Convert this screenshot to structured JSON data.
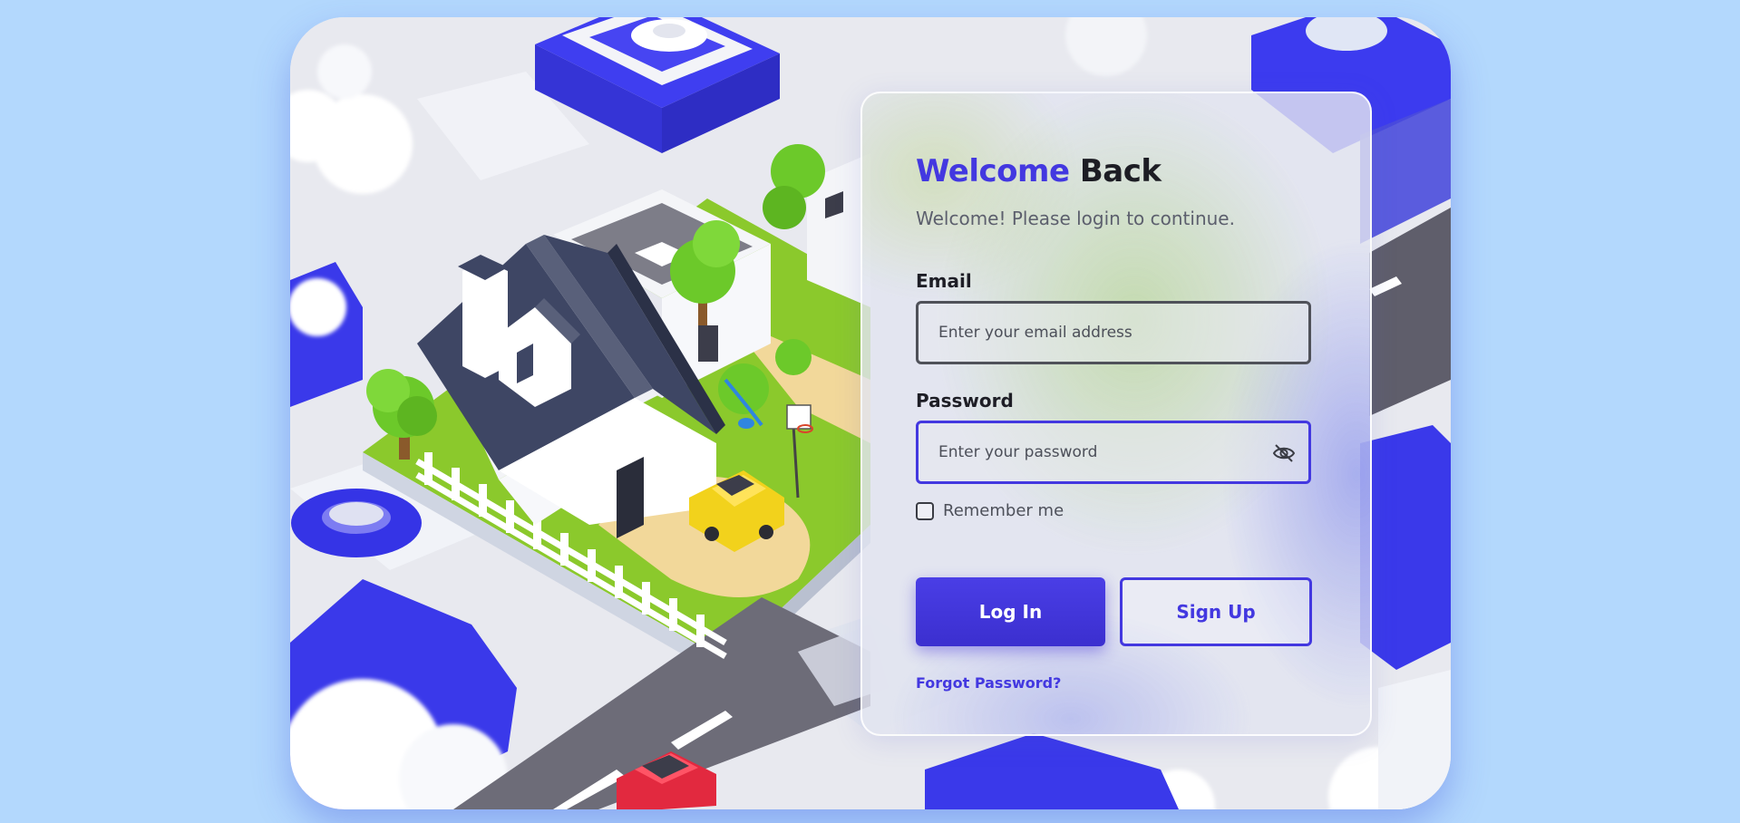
{
  "login": {
    "title_accent": "Welcome",
    "title_rest": "Back",
    "subtitle": "Welcome! Please login to continue.",
    "email": {
      "label": "Email",
      "placeholder": "Enter your email address",
      "value": ""
    },
    "password": {
      "label": "Password",
      "placeholder": "Enter your password",
      "value": "",
      "toggle_icon": "eye-off-icon"
    },
    "remember_label": "Remember me",
    "remember_checked": false,
    "login_button": "Log In",
    "signup_button": "Sign Up",
    "forgot_link": "Forgot Password?"
  },
  "colors": {
    "page_bg": "#b3d8fd",
    "accent": "#4338e0",
    "text_dark": "#1d1d24",
    "text_muted": "#5c5f6d"
  }
}
